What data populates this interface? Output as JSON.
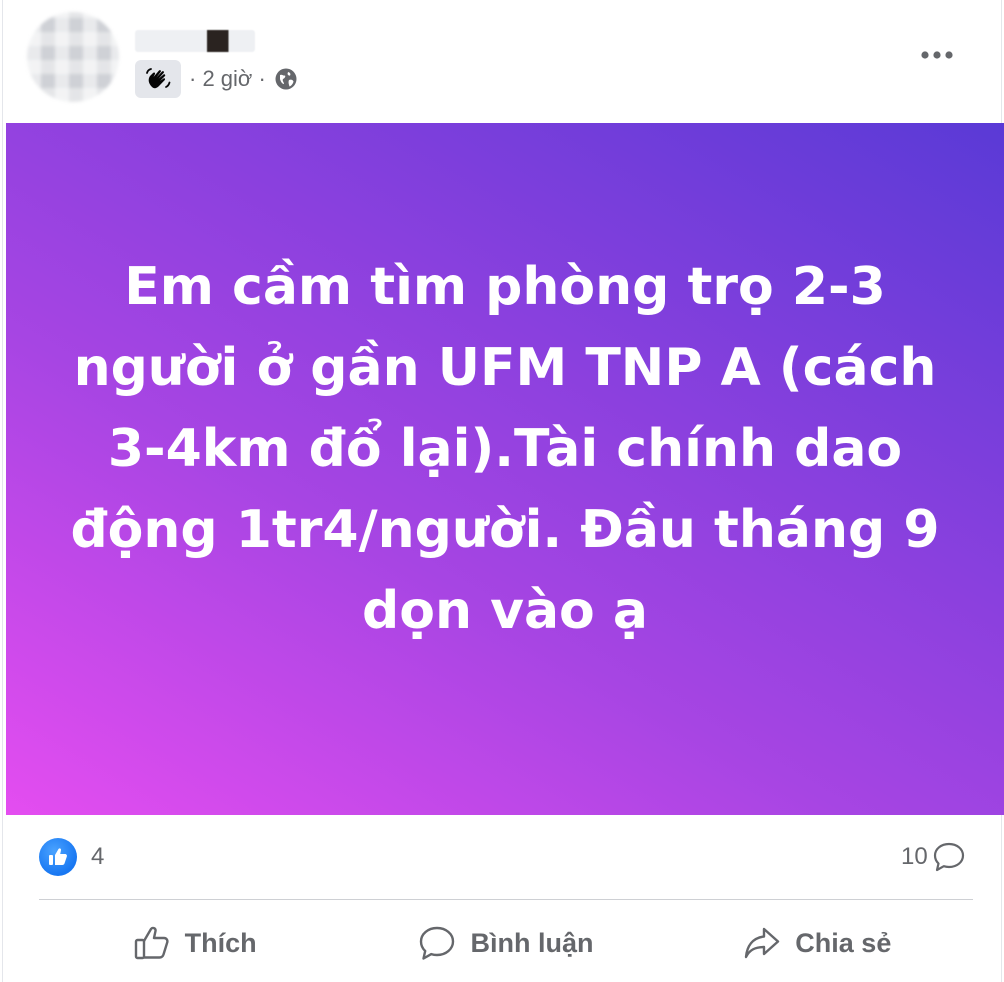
{
  "post": {
    "author_name": "",
    "timestamp": "· 2 giờ ·",
    "privacy_icon": "globe-icon",
    "badge_icon": "waving-hand-icon",
    "more_icon": "more-horizontal-icon",
    "banner_text": "Em cầm tìm phòng trọ 2-3 người ở gần UFM TNP A (cách 3-4km đổ lại).Tài chính dao động 1tr4/người. Đầu tháng 9 dọn vào ạ",
    "banner_gradient": [
      "#e44df0",
      "#a745e3",
      "#8a40de",
      "#5a3ad6"
    ]
  },
  "reactions": {
    "like_count": "4",
    "comment_count": "10",
    "accent": "#1877f2"
  },
  "actions": {
    "like_label": "Thích",
    "comment_label": "Bình luận",
    "share_label": "Chia sẻ"
  }
}
